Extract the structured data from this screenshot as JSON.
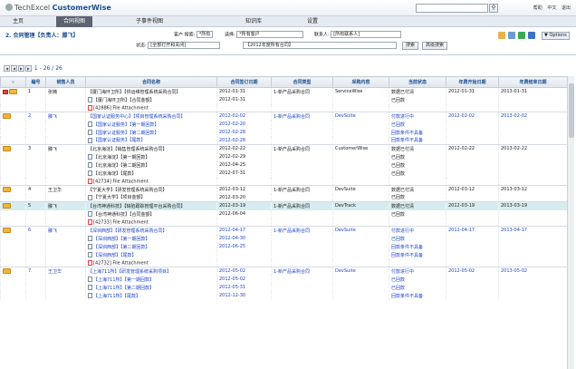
{
  "header": {
    "brand_prefix": "TechExcel",
    "brand": "CustomerWise",
    "search_placeholder": "",
    "links": [
      "帮助",
      "中文",
      "退出"
    ]
  },
  "nav": {
    "tabs": [
      {
        "label": "主页",
        "active": false
      },
      {
        "label": "合同视图",
        "active": true
      },
      {
        "label": "子事件视图",
        "active": false
      },
      {
        "label": "知识库",
        "active": false
      },
      {
        "label": "设置",
        "active": false
      }
    ]
  },
  "toolbar": {
    "breadcrumb": "2. 合同管理【负责人：滕飞】",
    "customer_label": "客户 搜索:",
    "customer_value": "*所有",
    "select_label": "选择:",
    "select_value": "*所有客户",
    "contact_label": "联系人:",
    "contact_value": "[所有联系人]",
    "status_label": "状态:",
    "status_value": "[全部打开和关闭]",
    "year_value": "【2012年度所有合同】",
    "search_button": "搜索",
    "advanced_button": "高级搜索",
    "options_label": "Options"
  },
  "pager": {
    "range": "1 - 26 / 26"
  },
  "table": {
    "columns": [
      "",
      "编号",
      "销售人员",
      "合同名称",
      "合同签订日期",
      "合同类型",
      "采购内容",
      "当前状态",
      "年费开始日期",
      "年费结束日期"
    ],
    "rows": [
      {
        "kind": "main",
        "blue": false,
        "hl": false,
        "flag": true,
        "num": "1",
        "sales": "张楠",
        "name": "【厦门海环卫所】【供运维管理系统采购合同】",
        "date": "2012-01-31",
        "type": "1-新产品采购合同",
        "product": "ServiceWise",
        "status": "数据已付清",
        "start": "2012-01-31",
        "end": "2013-01-31"
      },
      {
        "kind": "sub",
        "name": "【厦门海环卫所】【合同金额】",
        "date": "2012-01-31",
        "status": "已回款"
      },
      {
        "kind": "attach",
        "name": "[42886] File Attachment"
      },
      {
        "kind": "main",
        "blue": true,
        "hl": false,
        "flag": false,
        "num": "2",
        "sales": "滕飞",
        "name": "【国家认证服务中心】【项目管理系统采购合同】",
        "date": "2012-02-02",
        "type": "1-新产品采购合同",
        "product": "DevSuite",
        "status": "付款进行中",
        "start": "2012-02-02",
        "end": "2013-02-02"
      },
      {
        "kind": "sub",
        "blue": true,
        "name": "【国家认证服务】【第一期回款】",
        "date": "2012-02-20",
        "status": "已回款"
      },
      {
        "kind": "sub",
        "blue": true,
        "name": "【国家认证服务】【第二期回款】",
        "date": "2012-02-28",
        "status": "回款条件不具备"
      },
      {
        "kind": "sub",
        "blue": true,
        "name": "【国家认证服务】【尾款】",
        "date": "2012-02-28",
        "status": "回款条件不具备"
      },
      {
        "kind": "main",
        "blue": false,
        "hl": false,
        "flag": false,
        "num": "3",
        "sales": "滕飞",
        "name": "【北京海淀】【销售管理系统采购合同】",
        "date": "2012-02-22",
        "type": "1-新产品采购合同",
        "product": "CustomerWise",
        "status": "数据已付清",
        "start": "2012-02-22",
        "end": "2013-02-22"
      },
      {
        "kind": "sub",
        "name": "【北京海淀】【第一期回款】",
        "date": "2012-02-29",
        "status": "已回款"
      },
      {
        "kind": "sub",
        "name": "【北京海淀】【第二期回款】",
        "date": "2012-04-25",
        "status": "已回款"
      },
      {
        "kind": "sub",
        "name": "【北京海淀】【尾款】",
        "date": "2012-07-31",
        "status": "已回款"
      },
      {
        "kind": "attach",
        "name": "[42734] File Attachment"
      },
      {
        "kind": "main",
        "blue": false,
        "hl": false,
        "flag": false,
        "num": "4",
        "sales": "王卫华",
        "name": "【宁夏大学】【研发管理系统采购合同】",
        "date": "2012-03-12",
        "type": "1-新产品采购合同",
        "product": "DevSuite",
        "status": "数据已付清",
        "start": "2012-03-12",
        "end": "2013-03-12"
      },
      {
        "kind": "sub",
        "name": "【宁夏大学】【项目金额】",
        "date": "2012-03-20",
        "status": "已回款"
      },
      {
        "kind": "main",
        "blue": false,
        "hl": true,
        "flag": false,
        "num": "5",
        "sales": "滕飞",
        "name": "【台湾神通科技】【缺陷跟踪管理平台采购合同】",
        "date": "2012-03-19",
        "type": "1-新产品采购合同",
        "product": "DevTrack",
        "status": "数据已付清",
        "start": "2012-03-19",
        "end": "2013-03-19"
      },
      {
        "kind": "sub",
        "name": "【台湾神通科技】【合同金额】",
        "date": "2012-06-04",
        "status": "已回款"
      },
      {
        "kind": "attach",
        "name": "[42733] File Attachment"
      },
      {
        "kind": "main",
        "blue": true,
        "hl": false,
        "flag": false,
        "num": "6",
        "sales": "滕飞",
        "name": "【深圳西部】【研发管理系统采购合同】",
        "date": "2012-04-17",
        "type": "1-新产品采购合同",
        "product": "DevSuite",
        "status": "付款进行中",
        "start": "2012-04-17",
        "end": "2013-04-17"
      },
      {
        "kind": "sub",
        "blue": true,
        "name": "【深圳西部】【第一期回款】",
        "date": "2012-04-30",
        "status": "已回款"
      },
      {
        "kind": "sub",
        "blue": true,
        "name": "【深圳西部】【第二期回款】",
        "date": "2012-06-25",
        "status": "回款条件不具备"
      },
      {
        "kind": "sub",
        "blue": true,
        "name": "【深圳西部】【尾款】",
        "date": "",
        "status": "回款条件不具备"
      },
      {
        "kind": "attach",
        "name": "[42732] File Attachment"
      },
      {
        "kind": "main",
        "blue": true,
        "hl": false,
        "flag": false,
        "num": "7",
        "sales": "王卫华",
        "name": "【上海711所】【研发管理系统采购项目】",
        "date": "2012-05-02",
        "type": "1-新产品采购合同",
        "product": "DevSuite",
        "status": "付款进行中",
        "start": "2012-05-02",
        "end": "2013-05-02"
      },
      {
        "kind": "sub",
        "blue": true,
        "name": "【上海711所】【第一期回款】",
        "date": "2012-05-02",
        "status": "已回款"
      },
      {
        "kind": "sub",
        "blue": true,
        "name": "【上海711所】【第二期回款】",
        "date": "2012-05-31",
        "status": "已回款"
      },
      {
        "kind": "sub",
        "blue": true,
        "name": "【上海711所】【尾款】",
        "date": "2012-12-30",
        "status": "回款条件不具备"
      }
    ]
  }
}
